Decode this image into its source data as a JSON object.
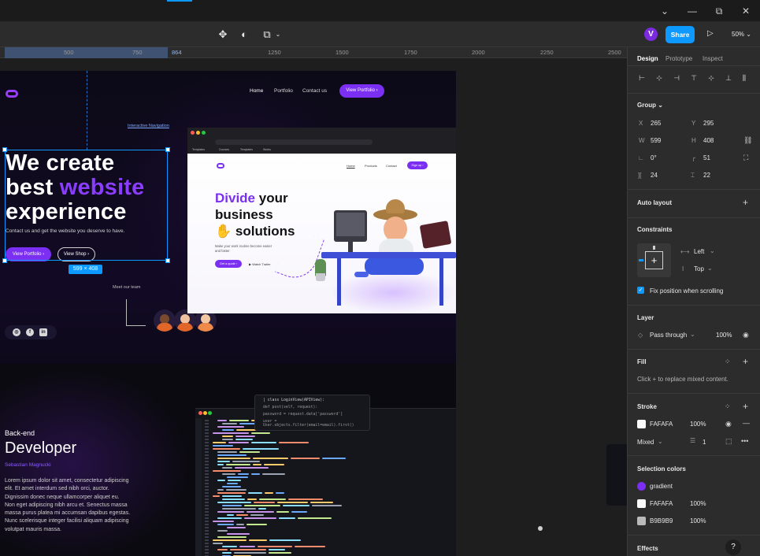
{
  "window": {
    "minimize_icon": "chevron-down-icon",
    "controls": [
      "⌄",
      "—",
      "⧉",
      "✕"
    ]
  },
  "toolbar": {
    "avatar_letter": "V",
    "share_label": "Share",
    "zoom": "50%"
  },
  "ruler": {
    "ticks": [
      "500",
      "750",
      "864",
      "1250",
      "1500",
      "1750",
      "2000",
      "2250",
      "2500"
    ]
  },
  "canvas": {
    "nav": {
      "home": "Home",
      "portfolio": "Portfolio",
      "contact": "Contact us",
      "cta": "View Portfolio ›"
    },
    "hero": {
      "line1": "We create",
      "line2a": "best ",
      "line2b": "website",
      "line3": "experience",
      "subline": "Contact us and get the website you deserve to have.",
      "btn_portfolio": "View Portfolio ›",
      "btn_shop": "View Shop ›"
    },
    "selection_size": "599 × 408",
    "interactive_nav": "Interactive Navigation",
    "meet_team": "Meet our team",
    "browser": {
      "bookmarks": [
        "Templates",
        "Courses",
        "Templates",
        "Works"
      ],
      "nav": [
        "Home",
        "Products",
        "Contact"
      ],
      "signup": "Sign up ›",
      "h1_a": "Divide",
      "h1_b": " your",
      "h1_c": "business",
      "h1_d": "solutions",
      "sub": "Make your work routine become easier and faster",
      "getq": "Get a quote ›",
      "watch": "▶ Watch Trailer"
    },
    "code_popup": [
      "| class LoginView(APIView):",
      "  def post(self, request):",
      "    password = request.data['password']",
      "    user = User.objects.filter(email=email).first()"
    ],
    "backend": {
      "small": "Back-end",
      "big": "Developer",
      "name": "Sebastian Magnucki",
      "para": "Lorem ipsum dolor sit amet, consectetur adipiscing elit. Et amet interdum sed nibh orci, auctor. Dignissim donec neque ullamcorper aliquet eu. Non eget adipiscing nibh arcu et. Senectus massa massa purus platea mi accumsan dapibus egestas. Nunc scelerisque integer facilisi aliquam adipiscing volutpat mauris massa."
    }
  },
  "panel": {
    "tabs": [
      "Design",
      "Prototype",
      "Inspect"
    ],
    "group": {
      "title": "Group ⌄",
      "x_label": "X",
      "x": "265",
      "y_label": "Y",
      "y": "295",
      "w_label": "W",
      "w": "599",
      "h_label": "H",
      "h": "408",
      "rot": "0°",
      "radius": "51",
      "pad_h": "24",
      "pad_v": "22"
    },
    "auto_layout": "Auto layout",
    "constraints": {
      "title": "Constraints",
      "horizontal": "Left",
      "vertical": "Top",
      "fix_label": "Fix position when scrolling"
    },
    "layer": {
      "title": "Layer",
      "blend": "Pass through",
      "opacity": "100%"
    },
    "fill": {
      "title": "Fill",
      "hint": "Click + to replace mixed content."
    },
    "stroke": {
      "title": "Stroke",
      "color": "FAFAFA",
      "opacity": "100%",
      "position": "Mixed",
      "weight": "1"
    },
    "selection_colors": {
      "title": "Selection colors",
      "items": [
        {
          "name": "gradient",
          "opacity": ""
        },
        {
          "name": "FAFAFA",
          "opacity": "100%"
        },
        {
          "name": "B9B9B9",
          "opacity": "100%"
        }
      ]
    },
    "effects": "Effects"
  },
  "colors": {
    "accent": "#0d99ff",
    "brand_purple": "#7b2ff2"
  }
}
